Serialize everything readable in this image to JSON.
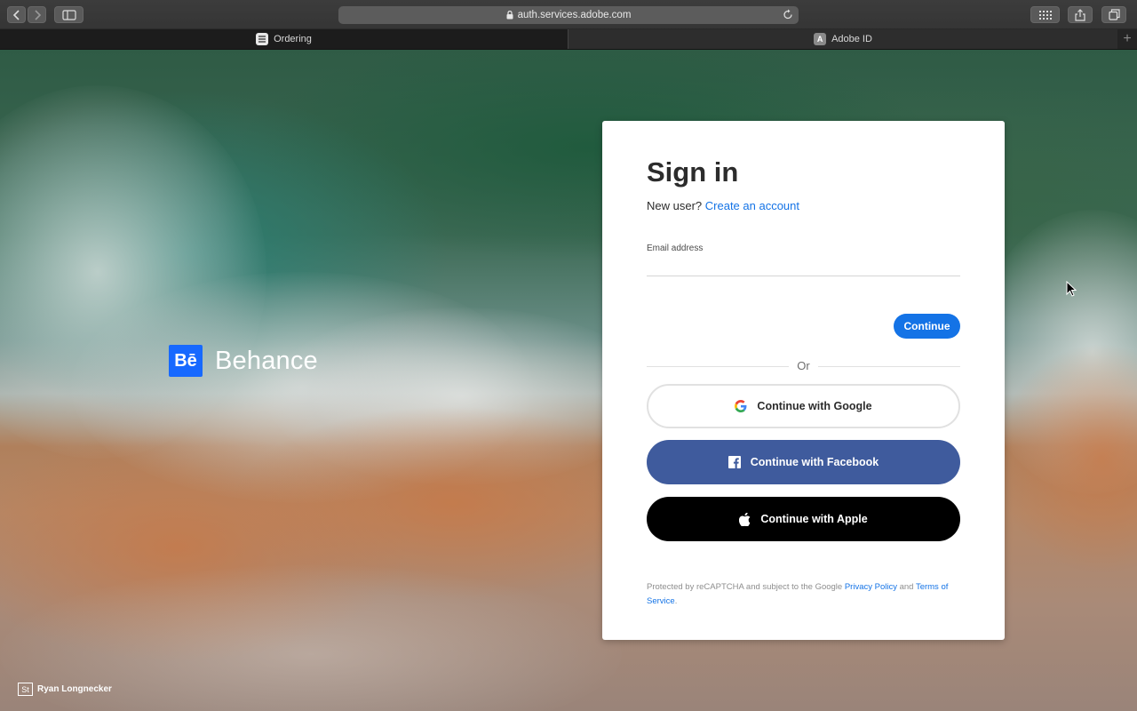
{
  "browser": {
    "url": "auth.services.adobe.com",
    "tabs": [
      {
        "label": "Ordering",
        "active": false
      },
      {
        "label": "Adobe ID",
        "active": true,
        "favicon_letter": "A"
      }
    ],
    "new_tab_symbol": "+"
  },
  "brand": {
    "mark": "Bē",
    "name": "Behance",
    "color": "#1769ff"
  },
  "credit": {
    "badge": "St",
    "author": "Ryan Longnecker"
  },
  "signin": {
    "title": "Sign in",
    "new_user_prompt": "New user?",
    "create_account_link": "Create an account",
    "email_label": "Email address",
    "email_value": "",
    "continue_label": "Continue",
    "or_label": "Or",
    "google_label": "Continue with Google",
    "facebook_label": "Continue with Facebook",
    "apple_label": "Continue with Apple",
    "legal": {
      "prefix": "Protected by reCAPTCHA and subject to the Google",
      "privacy_link": "Privacy Policy",
      "and": "and",
      "terms_link": "Terms of Service",
      "suffix": "."
    },
    "colors": {
      "accent": "#1473e6",
      "facebook": "#3f5b9d",
      "apple": "#000000"
    }
  }
}
